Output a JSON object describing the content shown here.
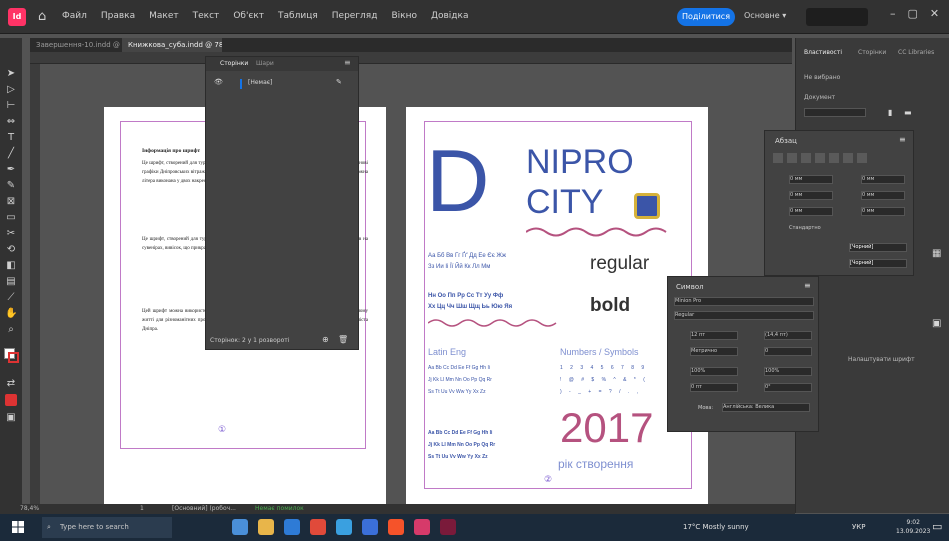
{
  "app": {
    "menus": [
      "Файл",
      "Правка",
      "Макет",
      "Текст",
      "Об'єкт",
      "Таблиця",
      "Перегляд",
      "Вікно",
      "Довідка"
    ],
    "share_label": "Поділитися",
    "workspace_label": "Основне ▾",
    "tabs": [
      "Завершення-10.indd @ 78% [Перетворено]",
      "Книжкова_суба.indd @ 78% [Перетворено]"
    ]
  },
  "pages_panel": {
    "tabs": [
      "Сторінки",
      "Шари"
    ],
    "item": "[Немає]",
    "footer": "Сторінок: 2 у 1 розвороті"
  },
  "left_page": {
    "heading": "Інформація про шрифт",
    "paragraphs": [
      "Це шрифт, створений для туристичного бренду міста Дніпро. Він був розроблений в 2017 році на основі графіки Днiпровських вітражів та вивісок. Шрифт сучасний, має кириличні та латинські символи. Кожна літера виконана у двох накресленнях: regular та bold.",
      "Це шрифт, створений для туристичного бренду міста Дніпро. Він підходить для заголовків, написів на сувенірах, вивісок, що прикрашають вулиці міста та надають інформацію туристам.",
      "Цей шрифт можна використовувати для створення туристичного брендингу, а також в повсякденному житті для різноманітних проектів. Він надає текстам неповторний характер, що відображає дух міста Дніпра."
    ],
    "page_number": "①"
  },
  "right_page": {
    "logo_letter": "D",
    "logo_line1": "NIPRO",
    "logo_line2": "CITY",
    "cyr_line1": "Аа Бб Вв Гг Ґґ Дд Ее Єє Жж",
    "cyr_line2": "Зз Ии Іі Її Йй Кк Лл Мм",
    "cyr_line3": "Нн Оо Пп Рр Сс Тт Уу Фф",
    "cyr_line4": "Хх Цц Чч Шш Щщ Ьь Юю Яя",
    "regular": "regular",
    "bold": "bold",
    "latin_title": "Latin Eng",
    "latin_lines": [
      "Aa Bb Cc Dd Ee Ff Gg Hh Ii",
      "Jj Kk Ll Mm Nn Oo Pp Qq Rr",
      "Ss Tt Uu Vv Ww Yy Xx Zz"
    ],
    "numbers_title": "Numbers / Symbols",
    "numbers_lines": [
      "1 2 3 4 5 6 7 8 9",
      "! @ # $ % ^ & * (",
      ") - _ + = ? / . ,"
    ],
    "year": "2017",
    "year_caption": "рік створення"
  },
  "right_panel": {
    "tabs": [
      "Властивості",
      "Сторінки",
      "CC Libraries"
    ],
    "section1": "Не вибрано",
    "section2": "Документ",
    "bottom_label": "Налаштувати шрифт"
  },
  "effects_panel": {
    "title": "Абзац",
    "fields": [
      "0 мм",
      "0 мм",
      "0 мм",
      "0 мм",
      "0 мм",
      "0 мм",
      "Стандартно"
    ],
    "color1": "[Чорний]",
    "color2": "[Чорний]"
  },
  "char_panel": {
    "title": "Символ",
    "font": "Minion Pro",
    "style": "Regular",
    "size": "12 пт",
    "leading": "(14,4 пт)",
    "kerning": "Метрично",
    "tracking": "0",
    "scale_v": "100%",
    "scale_h": "100%",
    "baseline": "0 пт",
    "skew": "0°",
    "lang": "Мова:",
    "lang_value": "Англійська: Велика"
  },
  "status": {
    "zoom": "78,4%",
    "page": "1",
    "preset": "[Основний] (робоч...",
    "errors": "Немає помилок"
  },
  "taskbar": {
    "search": "Type here to search",
    "weather": "17°C  Mostly sunny",
    "lang": "УКР",
    "time": "9:02",
    "date": "13.09.2023"
  },
  "colors": {
    "logo_blue": "#3b55a8",
    "accent_magenta": "#b5527f",
    "share_blue": "#1473e6",
    "app_pink": "#ff3366"
  }
}
